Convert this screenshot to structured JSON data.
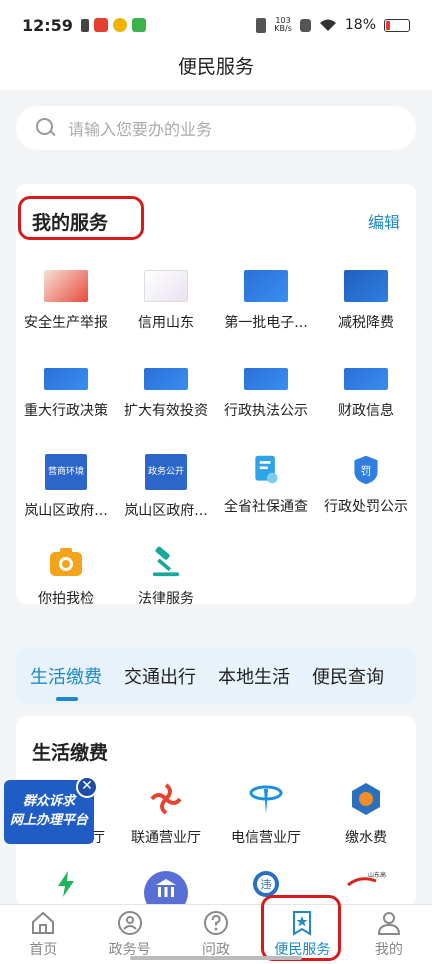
{
  "status": {
    "time": "12:59",
    "net_top": "103",
    "net_bottom": "KB/s",
    "battery": "18%"
  },
  "header": {
    "title": "便民服务"
  },
  "search": {
    "placeholder": "请输入您要办的业务"
  },
  "my_services": {
    "title": "我的服务",
    "edit": "编辑",
    "items": [
      {
        "label": "安全生产举报",
        "icon": "safety-report-banner"
      },
      {
        "label": "信用山东",
        "icon": "credit-shandong-banner"
      },
      {
        "label": "第一批电子...",
        "icon": "e-license-banner"
      },
      {
        "label": "减税降费",
        "icon": "tax-cut-banner"
      },
      {
        "label": "重大行政决策",
        "icon": "admin-decision-banner"
      },
      {
        "label": "扩大有效投资",
        "icon": "investment-banner"
      },
      {
        "label": "行政执法公示",
        "icon": "law-enforcement-banner"
      },
      {
        "label": "财政信息",
        "icon": "finance-info-banner"
      },
      {
        "label": "岚山区政府...",
        "icon": "business-env-icon",
        "icon_text": "营商环境"
      },
      {
        "label": "岚山区政府...",
        "icon": "gov-open-icon",
        "icon_text": "政务公开"
      },
      {
        "label": "全省社保通查",
        "icon": "social-security-icon"
      },
      {
        "label": "行政处罚公示",
        "icon": "penalty-icon",
        "icon_text": "罚"
      },
      {
        "label": "你拍我检",
        "icon": "camera-icon"
      },
      {
        "label": "法律服务",
        "icon": "gavel-icon"
      }
    ]
  },
  "tabs": [
    {
      "label": "生活缴费",
      "active": true
    },
    {
      "label": "交通出行",
      "active": false
    },
    {
      "label": "本地生活",
      "active": false
    },
    {
      "label": "便民查询",
      "active": false
    }
  ],
  "life": {
    "title": "生活缴费",
    "items": [
      {
        "label": "业厅",
        "icon": "mobile-hall-icon"
      },
      {
        "label": "联通营业厅",
        "icon": "unicom-icon"
      },
      {
        "label": "电信营业厅",
        "icon": "telecom-icon"
      },
      {
        "label": "缴水费",
        "icon": "water-fee-icon"
      }
    ],
    "row2_icons": [
      "electric-icon",
      "bank-icon",
      "violation-icon",
      "shandong-highspeed-icon"
    ],
    "row2_violation_glyph": "违",
    "row2_highspeed_text": "山东高速"
  },
  "floating": {
    "line1": "群众诉求",
    "line2": "网上办理平台",
    "close": "✕"
  },
  "bottom_nav": [
    {
      "label": "首页",
      "icon": "home-icon"
    },
    {
      "label": "政务号",
      "icon": "gov-account-icon"
    },
    {
      "label": "问政",
      "icon": "question-icon"
    },
    {
      "label": "便民服务",
      "icon": "star-bookmark-icon",
      "active": true
    },
    {
      "label": "我的",
      "icon": "user-icon"
    }
  ],
  "colors": {
    "accent": "#1e88c9",
    "highlight": "#d71a1a"
  }
}
